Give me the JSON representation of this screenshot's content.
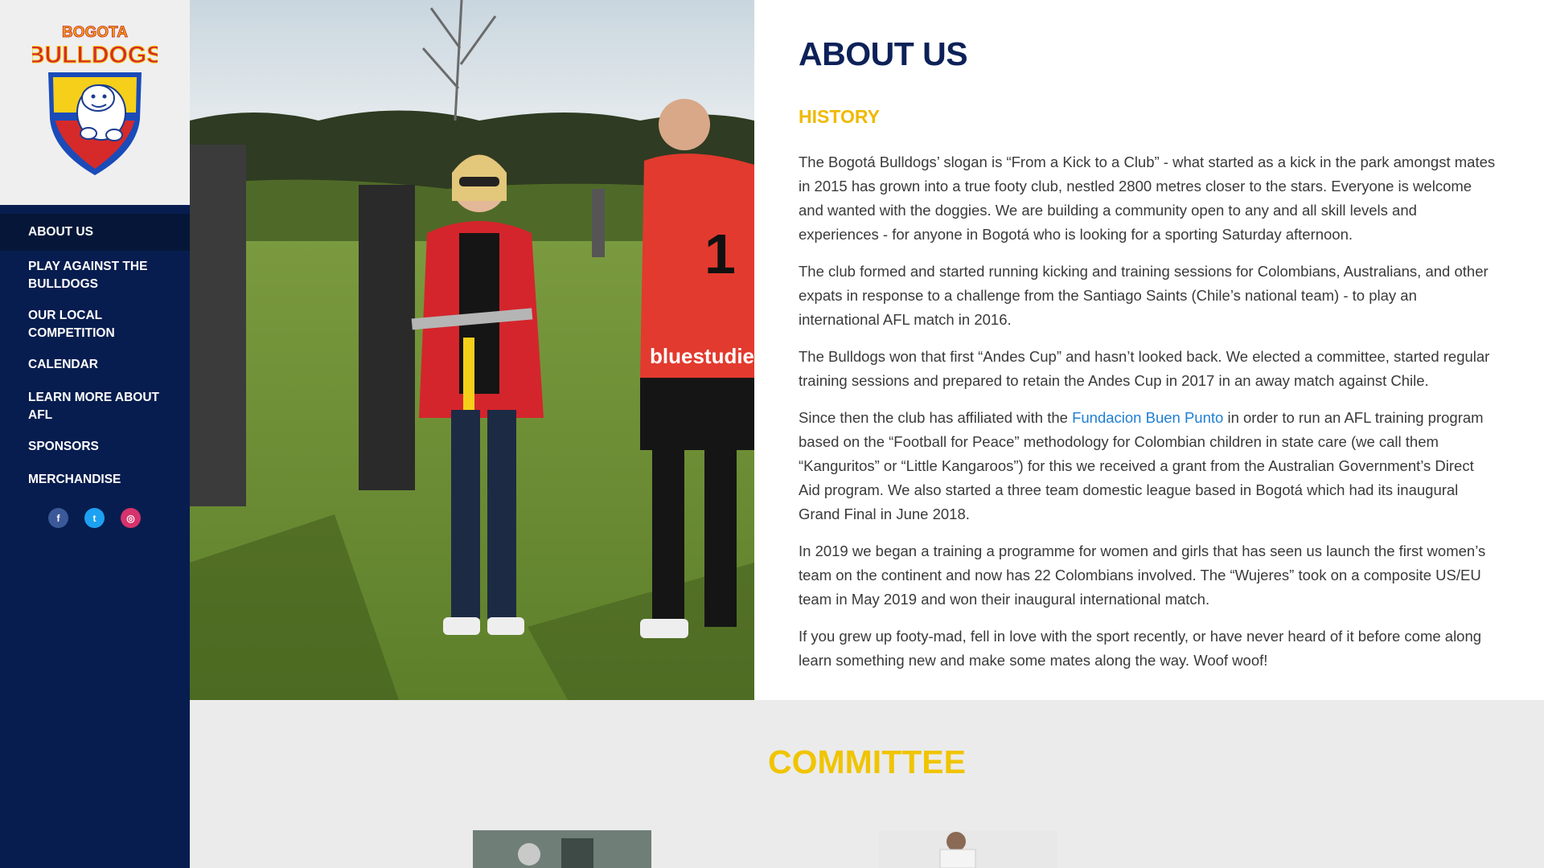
{
  "logo": {
    "line1": "BOGOTA",
    "line2": "BULLDOGS"
  },
  "nav": {
    "items": [
      {
        "label": "ABOUT US",
        "active": true
      },
      {
        "label": "PLAY AGAINST THE BULLDOGS"
      },
      {
        "label": "OUR LOCAL COMPETITION"
      },
      {
        "label": "CALENDAR"
      },
      {
        "label": "LEARN MORE ABOUT AFL"
      },
      {
        "label": "SPONSORS"
      },
      {
        "label": "MERCHANDISE"
      }
    ]
  },
  "socials": [
    {
      "icon": "facebook-icon",
      "glyph": "f"
    },
    {
      "icon": "twitter-icon",
      "glyph": "t"
    },
    {
      "icon": "instagram-icon",
      "glyph": "◎"
    }
  ],
  "photo": {
    "shirt_number": "1",
    "sponsor": "bluestudies"
  },
  "about": {
    "title": "ABOUT US",
    "history_title": "HISTORY",
    "paragraphs": [
      "The Bogotá Bulldogs’ slogan is “From a Kick to a Club” - what started as a kick in the park amongst mates in 2015 has grown into a true footy club, nestled 2800 metres closer to the stars. Everyone is welcome and wanted with the doggies. We are building a community open to any and all skill levels and experiences - for anyone in Bogotá who is looking for a sporting Saturday afternoon.",
      "The club formed and started running kicking and training sessions for Colombians, Australians, and other expats in response to a challenge from the Santiago Saints (Chile’s national team) - to play an international AFL match in 2016.",
      "The Bulldogs won that first “Andes Cup” and hasn’t looked back. We elected a committee, started regular training sessions and prepared to retain the Andes Cup in 2017 in an away match against Chile.",
      "In 2019 we began a training a programme for women and girls that has seen us launch the first women’s team on the continent and now has 22 Colombians involved. The “Wujeres” took on a composite US/EU team in May 2019 and won their inaugural international match.",
      "If you grew up footy-mad, fell in love with the sport recently, or have never heard of it before come along learn something new and make some mates along the way. Woof woof!"
    ],
    "p4_before": "Since then the club has affiliated with the ",
    "p4_link": "Fundacion Buen Punto",
    "p4_after": " in order to run an AFL training program based on the “Football for Peace” methodology for Colombian children in state care (we call them “Kanguritos” or “Little Kangaroos”) for this we received a grant from the Australian Government’s Direct Aid program. We also started a three team domestic league based in Bogotá which had its inaugural Grand Final in June 2018."
  },
  "committee": {
    "title": "COMMITTEE"
  },
  "colors": {
    "navy": "#071d4f",
    "gold": "#f0b900",
    "link": "#1f7fd4"
  }
}
